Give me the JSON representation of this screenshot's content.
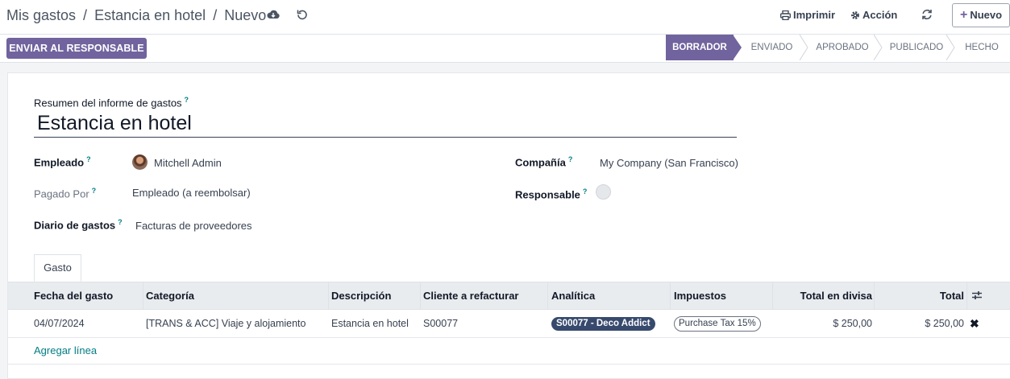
{
  "breadcrumb": [
    "Mis gastos",
    "Estancia en hotel",
    "Nuevo"
  ],
  "breadcrumb_sep": "/",
  "toolbar": {
    "print_label": "Imprimir",
    "action_label": "Acción",
    "new_label": "Nuevo"
  },
  "statusbar": {
    "send_label": "ENVIAR AL RESPONSABLE",
    "stages": [
      {
        "label": "BORRADOR",
        "active": true
      },
      {
        "label": "ENVIADO",
        "active": false
      },
      {
        "label": "APROBADO",
        "active": false
      },
      {
        "label": "PUBLICADO",
        "active": false
      },
      {
        "label": "HECHO",
        "active": false
      }
    ]
  },
  "form": {
    "summary_label": "Resumen del informe de gastos",
    "summary_value": "Estancia en hotel",
    "help_mark": "?",
    "employee_label": "Empleado",
    "employee_value": "Mitchell Admin",
    "paid_by_label": "Pagado Por",
    "paid_by_value": "Empleado (a reembolsar)",
    "journal_label": "Diario de gastos",
    "journal_value": "Facturas de proveedores",
    "company_label": "Compañía",
    "company_value": "My Company (San Francisco)",
    "responsible_label": "Responsable"
  },
  "tabs": [
    "Gasto"
  ],
  "table": {
    "columns": [
      "Fecha del gasto",
      "Categoría",
      "Descripción",
      "Cliente a refacturar",
      "Analítica",
      "Impuestos",
      "Total en divisa",
      "Total"
    ],
    "rows": [
      {
        "date": "04/07/2024",
        "category": "[TRANS & ACC] Viaje y alojamiento",
        "description": "Estancia en hotel",
        "customer": "S00077",
        "analytic": "S00077 - Deco Addict",
        "taxes": "Purchase Tax 15%",
        "total_currency": "$ 250,00",
        "total": "$ 250,00"
      }
    ],
    "add_line_label": "Agregar línea"
  },
  "colors": {
    "primary": "#71639e",
    "link": "#017e84",
    "analytic_pill": "#374a6d"
  }
}
